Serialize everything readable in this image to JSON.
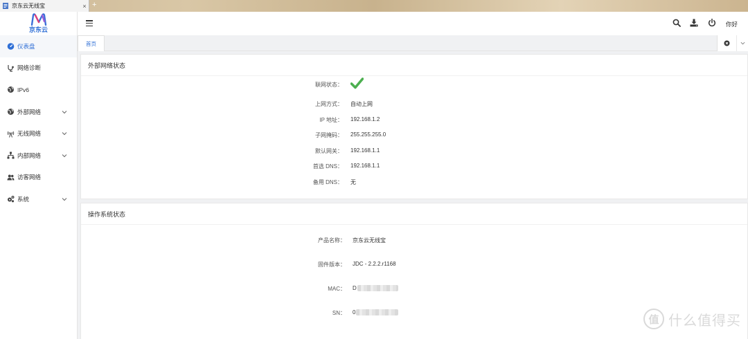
{
  "browser": {
    "tab_title": "京东云无线宝",
    "tab_close": "×",
    "new_tab": "+"
  },
  "sidebar": {
    "logo_text": "京东云",
    "items": [
      {
        "label": "仪表盘",
        "icon": "dashboard-icon",
        "active": true
      },
      {
        "label": "网络诊断",
        "icon": "stethoscope-icon"
      },
      {
        "label": "IPv6",
        "icon": "globe-icon"
      },
      {
        "label": "外部网络",
        "icon": "globe-icon",
        "expandable": true
      },
      {
        "label": "无线网络",
        "icon": "wifi-tower-icon",
        "expandable": true
      },
      {
        "label": "内部网络",
        "icon": "sitemap-icon",
        "expandable": true
      },
      {
        "label": "访客网络",
        "icon": "users-icon"
      },
      {
        "label": "系统",
        "icon": "cogs-icon",
        "expandable": true
      }
    ]
  },
  "header": {
    "hello": "你好",
    "icons": [
      "search-icon",
      "download-icon",
      "power-icon"
    ]
  },
  "tabs": {
    "home": "首页"
  },
  "external_status": {
    "title": "外部网络状态",
    "rows": [
      {
        "label": "联网状态：",
        "value": "",
        "icon": "check-icon",
        "icon_color": "#4caf50"
      },
      {
        "label": "上网方式：",
        "value": "自动上网"
      },
      {
        "label": "IP 地址：",
        "value": "192.168.1.2"
      },
      {
        "label": "子网掩码：",
        "value": "255.255.255.0"
      },
      {
        "label": "默认网关：",
        "value": "192.168.1.1"
      },
      {
        "label": "首选 DNS：",
        "value": "192.168.1.1"
      },
      {
        "label": "备用 DNS：",
        "value": "无"
      }
    ]
  },
  "system_status": {
    "title": "操作系统状态",
    "rows": [
      {
        "label": "产品名称：",
        "value": "京东云无线宝"
      },
      {
        "label": "固件版本：",
        "value": "JDC - 2.2.2.r1168"
      },
      {
        "label": "MAC：",
        "value": "D"
      },
      {
        "label": "SN：",
        "value": "0"
      }
    ]
  },
  "watermark": {
    "badge": "值",
    "text": "什么值得买"
  },
  "colors": {
    "accent": "#2f6fd6",
    "success": "#4caf50"
  }
}
